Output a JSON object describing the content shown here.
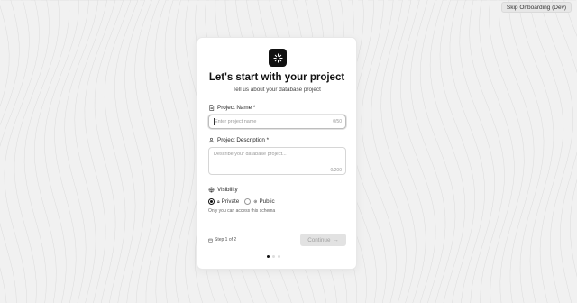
{
  "header": {
    "skip_label": "Skip Onboarding (Dev)"
  },
  "card": {
    "title": "Let's start with your project",
    "subtitle": "Tell us about your database project",
    "logo_icon": "sparkle-icon"
  },
  "project_name": {
    "label": "Project Name *",
    "placeholder": "Enter project name",
    "value": "",
    "counter": "0/50"
  },
  "project_description": {
    "label": "Project Description *",
    "placeholder": "Describe your database project...",
    "value": "",
    "counter": "0/200"
  },
  "visibility": {
    "label": "Visibility",
    "options": [
      {
        "label": "Private",
        "icon": "lock-icon",
        "selected": true
      },
      {
        "label": "Public",
        "icon": "globe-icon",
        "selected": false
      }
    ],
    "hint": "Only you can access this schema"
  },
  "footer": {
    "step_text": "Step 1 of 2",
    "continue_label": "Continue",
    "continue_enabled": false,
    "progress_dots": {
      "count": 3,
      "active": 1
    }
  },
  "colors": {
    "primary": "#111111",
    "background": "#f1f1f1",
    "disabled_button": "#e2e2e2"
  }
}
